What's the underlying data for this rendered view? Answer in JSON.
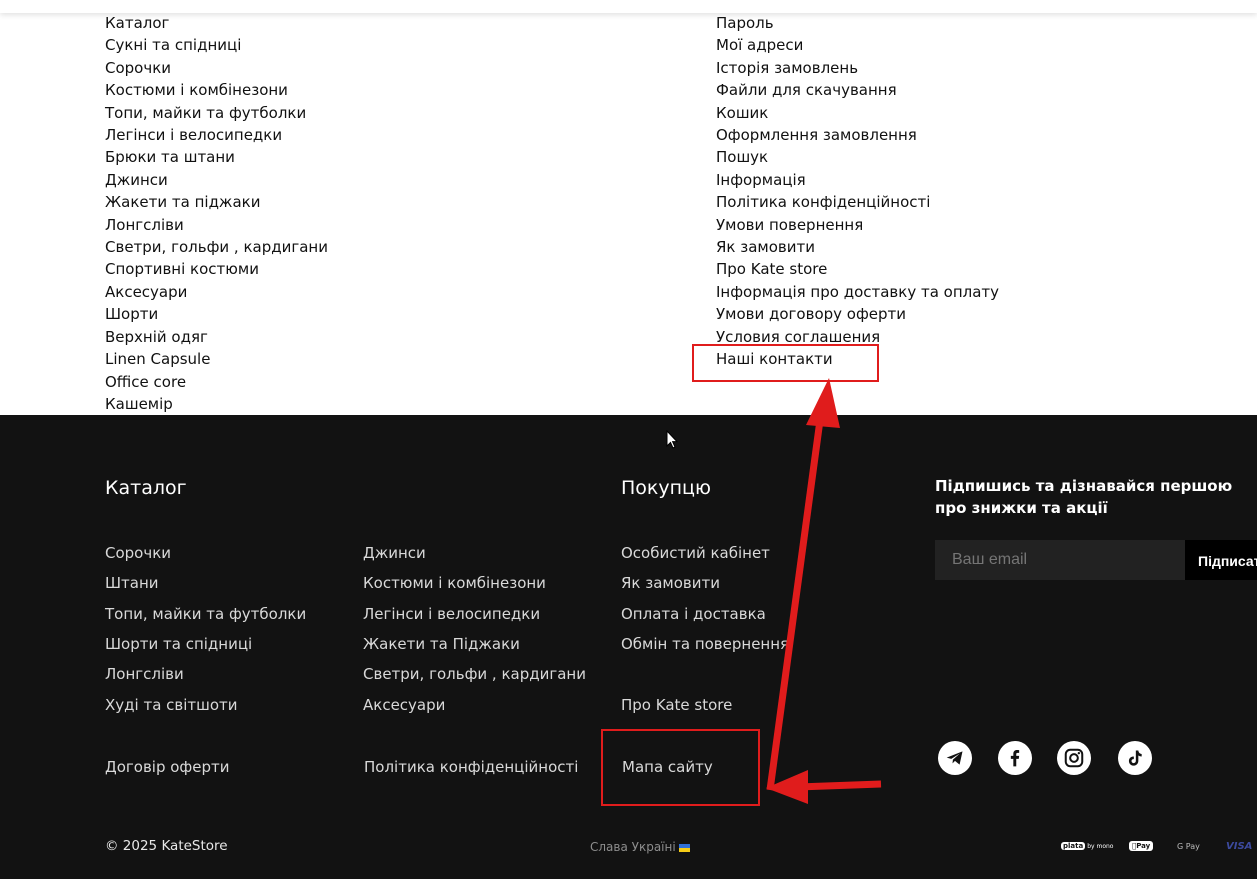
{
  "sitemap": {
    "left_links": [
      "Каталог",
      "Сукні та спідниці",
      "Сорочки",
      "Костюми і комбінезони",
      "Топи, майки та футболки",
      "Легінси і велосипедки",
      "Брюки та штани",
      "Джинси",
      "Жакети та піджаки",
      "Лонгсліви",
      "Светри, гольфи , кардигани",
      "Спортивні костюми",
      "Аксесуари",
      "Шорти",
      "Верхній одяг",
      "Linen Capsule",
      "Office core",
      "Кашемір"
    ],
    "right_links": [
      "Пароль",
      "Мої адреси",
      "Історія замовлень",
      "Файли для скачування",
      "Кошик",
      "Оформлення замовлення",
      "Пошук",
      "Інформація",
      "Політика конфіденційності",
      "Умови повернення",
      "Як замовити",
      "Про Kate store",
      "Інформація про доставку та оплату",
      "Умови договору оферти",
      "Условия соглашения",
      "Наші контакти"
    ]
  },
  "footer": {
    "catalog_title": "Каталог",
    "catalog_col1": [
      "Сорочки",
      "Штани",
      "Топи, майки та футболки",
      "Шорти та спідниці",
      "Лонгсліви",
      "Худі та світшоти"
    ],
    "catalog_col2": [
      "Джинси",
      "Костюми і комбінезони",
      "Легінси і велосипедки",
      "Жакети та Піджаки",
      "Светри, гольфи , кардигани",
      "Аксесуари"
    ],
    "buyer_title": "Покупцю",
    "buyer_links": [
      "Особистий кабінет",
      "Як замовити",
      "Оплата і доставка",
      "Обмін та повернення"
    ],
    "about": "Про Kate store",
    "offer": "Договір оферти",
    "privacy": "Політика конфіденційності",
    "sitemap": "Мапа сайту",
    "subscribe_title": "Підпишись та дізнавайся першою про знижки та акції",
    "email_placeholder": "Ваш email",
    "subscribe_button": "Підписатися",
    "social_icons": [
      "telegram-icon",
      "facebook-icon",
      "instagram-icon",
      "tiktok-icon"
    ],
    "copyright": "© 2025 KateStore",
    "glory": "Слава Україні",
    "payments": {
      "plata": "plata",
      "mono": "by mono",
      "apple": "Pay",
      "google": "G Pay",
      "visa": "VISA"
    }
  },
  "colors": {
    "footer_bg": "#121212",
    "annotation": "#e01c1c"
  }
}
